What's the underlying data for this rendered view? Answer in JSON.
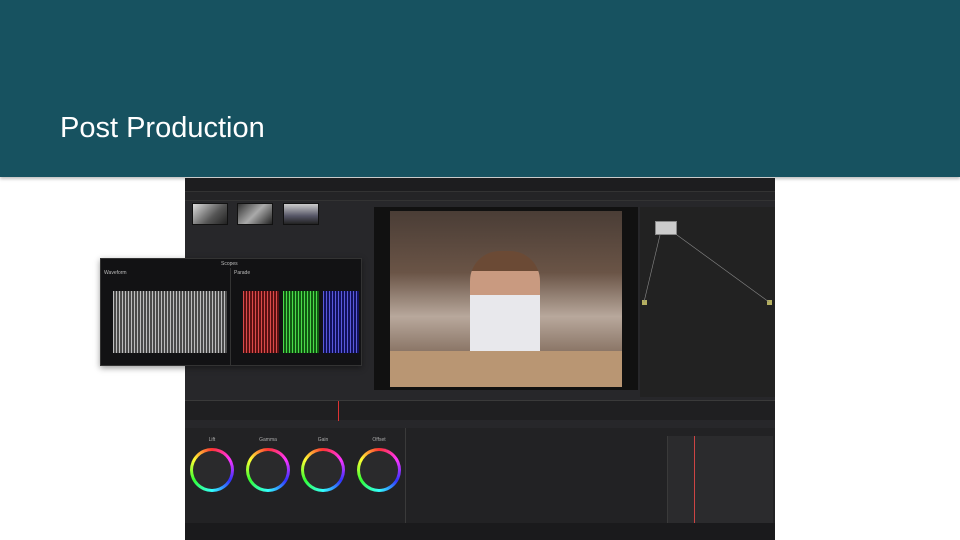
{
  "slide": {
    "title": "Post Production"
  },
  "scopes": {
    "panel_title": "Scopes",
    "left_scope": "Waveform",
    "right_scope": "Parade"
  },
  "color_wheels": [
    {
      "label": "Lift"
    },
    {
      "label": "Gamma"
    },
    {
      "label": "Gain"
    },
    {
      "label": "Offset"
    }
  ],
  "colors": {
    "header": "#175260",
    "app_bg": "#27272a"
  }
}
